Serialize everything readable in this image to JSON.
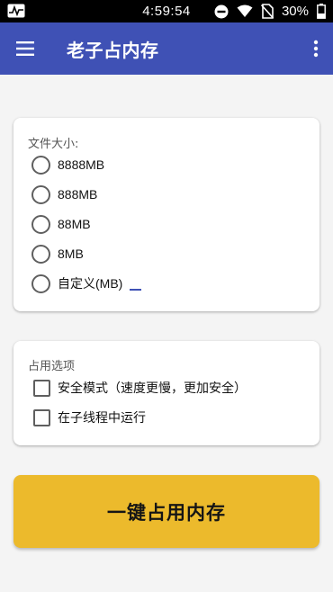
{
  "status_bar": {
    "time": "4:59:54",
    "battery": "30%",
    "icons": [
      "activity-icon",
      "do-not-disturb-icon",
      "wifi-icon",
      "no-sim-icon",
      "battery-icon"
    ]
  },
  "app_bar": {
    "title": "老子占内存",
    "menu_icon": "hamburger-menu-icon",
    "more_icon": "more-vert-icon",
    "color": "#3f51b5"
  },
  "size_card": {
    "label": "文件大小:",
    "options": [
      {
        "label": "8888MB",
        "selected": false
      },
      {
        "label": "888MB",
        "selected": false
      },
      {
        "label": "88MB",
        "selected": false
      },
      {
        "label": "8MB",
        "selected": false
      },
      {
        "label": "自定义(MB)",
        "selected": false,
        "input_value": ""
      }
    ]
  },
  "options_card": {
    "label": "占用选项",
    "checkboxes": [
      {
        "label": "安全模式（速度更慢，更加安全）",
        "checked": false
      },
      {
        "label": "在子线程中运行",
        "checked": false
      }
    ]
  },
  "action_button": {
    "label": "一键占用内存",
    "color": "#ecba2c"
  }
}
